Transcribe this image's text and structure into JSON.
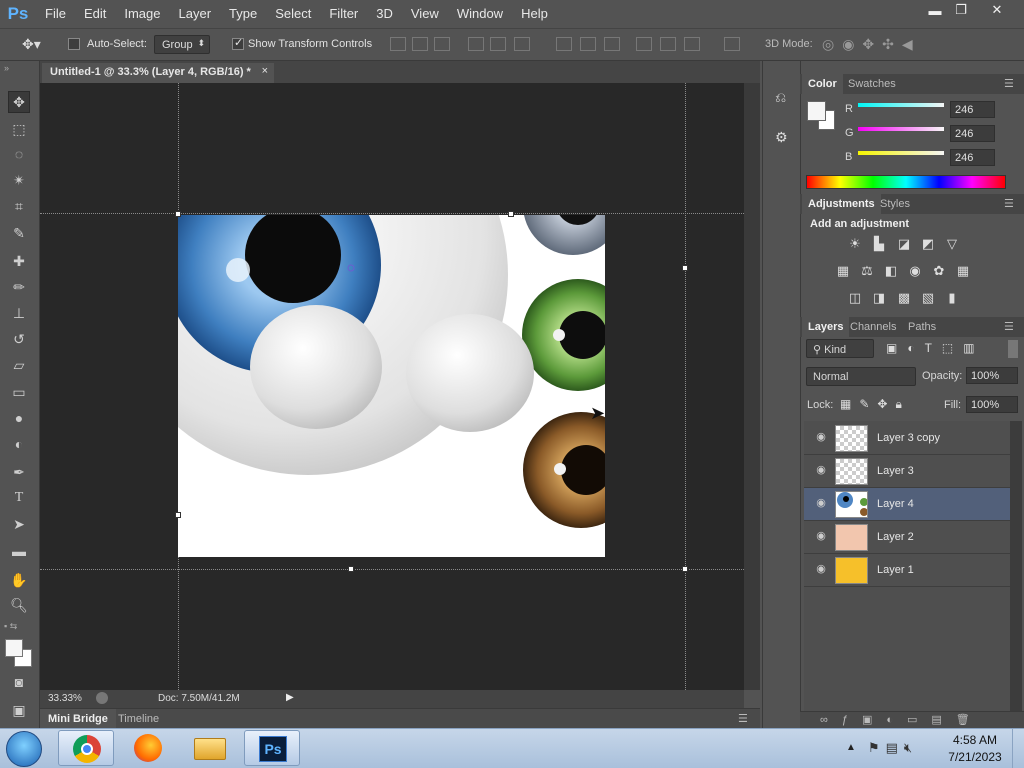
{
  "app": {
    "logo": "Ps"
  },
  "menubar": {
    "items": [
      "File",
      "Edit",
      "Image",
      "Layer",
      "Type",
      "Select",
      "Filter",
      "3D",
      "View",
      "Window",
      "Help"
    ]
  },
  "window_controls": {
    "minimize": "▬",
    "restore": "❐",
    "close": "✕"
  },
  "options": {
    "auto_select_label": "Auto-Select:",
    "auto_select_checked": false,
    "group_value": "Group",
    "show_transform_label": "Show Transform Controls",
    "show_transform_checked": true,
    "mode_3d_label": "3D Mode:"
  },
  "document": {
    "tab_title": "Untitled-1 @ 33.3% (Layer 4, RGB/16) *",
    "close": "×"
  },
  "status": {
    "zoom": "33.33%",
    "doc_info": "Doc: 7.50M/41.2M"
  },
  "bottom_tabs": [
    "Mini Bridge",
    "Timeline"
  ],
  "color_panel": {
    "tabs": [
      "Color",
      "Swatches"
    ],
    "channels": [
      {
        "label": "R",
        "value": "246",
        "color": "#00d8e8"
      },
      {
        "label": "G",
        "value": "246",
        "color": "#e040e0"
      },
      {
        "label": "B",
        "value": "246",
        "color": "#e8e800"
      }
    ]
  },
  "adjustments_panel": {
    "tabs": [
      "Adjustments",
      "Styles"
    ],
    "heading": "Add an adjustment"
  },
  "layers_panel": {
    "tabs": [
      "Layers",
      "Channels",
      "Paths"
    ],
    "filter_kind": "Kind",
    "blend_mode": "Normal",
    "opacity_label": "Opacity:",
    "opacity_value": "100%",
    "lock_label": "Lock:",
    "fill_label": "Fill:",
    "fill_value": "100%",
    "layers": [
      {
        "name": "Layer 3 copy",
        "selected": false
      },
      {
        "name": "Layer 3",
        "selected": false
      },
      {
        "name": "Layer 4",
        "selected": true
      },
      {
        "name": "Layer 2",
        "selected": false
      },
      {
        "name": "Layer 1",
        "selected": false
      }
    ]
  },
  "taskbar": {
    "time": "4:58 AM",
    "date": "7/21/2023",
    "ps_label": "Ps"
  }
}
